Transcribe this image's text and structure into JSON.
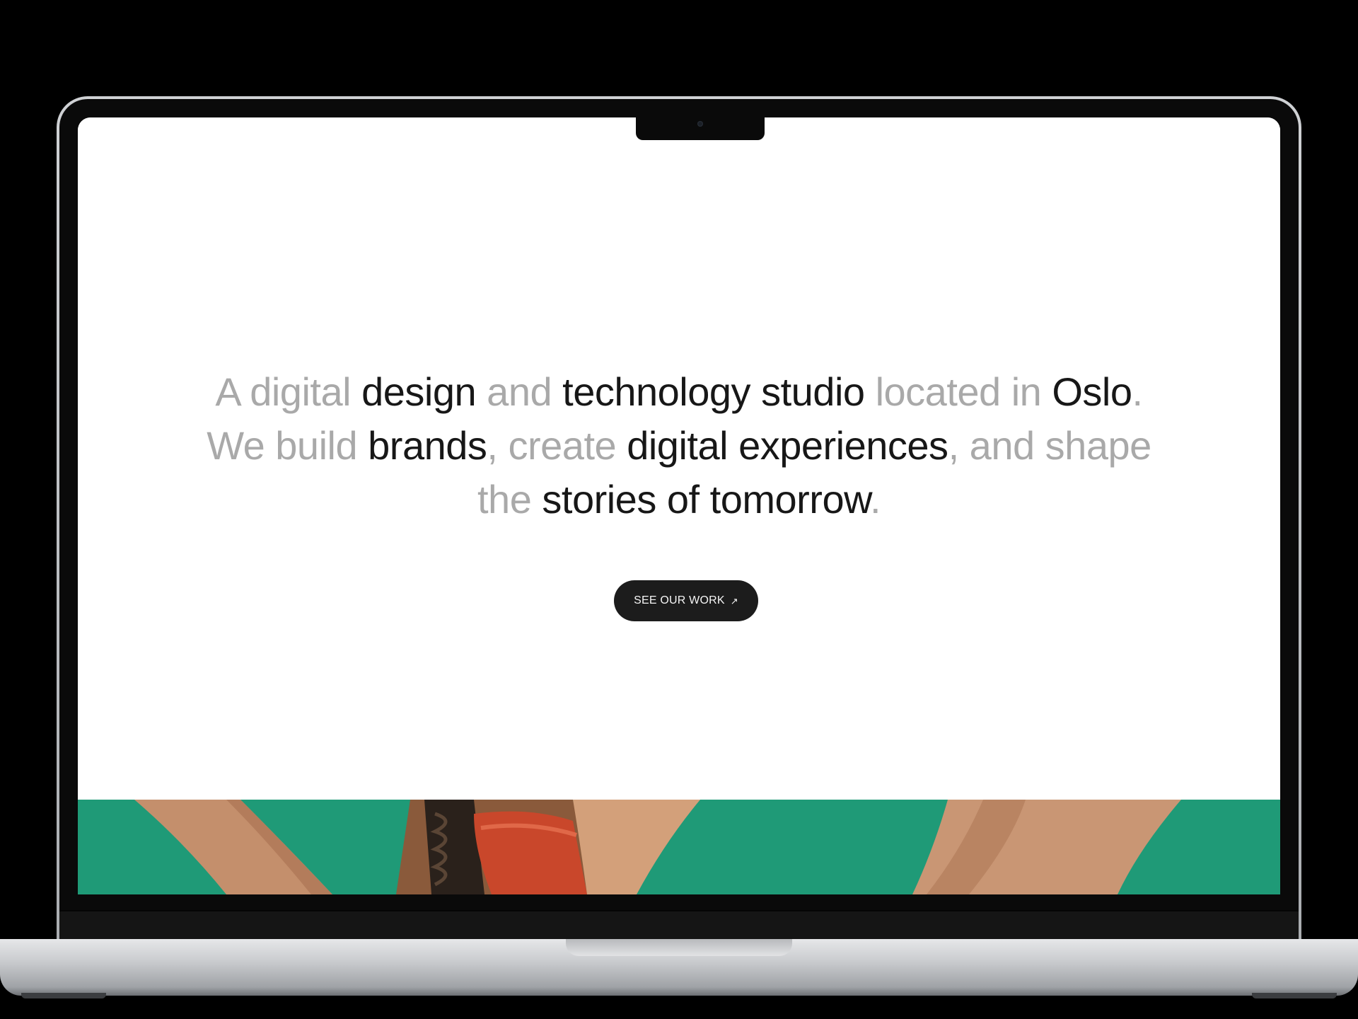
{
  "hero": {
    "headline_segments": [
      {
        "text": "A digital ",
        "tone": "muted"
      },
      {
        "text": "design ",
        "tone": "strong"
      },
      {
        "text": "and ",
        "tone": "muted"
      },
      {
        "text": "technology studio ",
        "tone": "strong"
      },
      {
        "text": "located in ",
        "tone": "muted"
      },
      {
        "text": "Oslo",
        "tone": "strong"
      },
      {
        "text": ".",
        "tone": "muted"
      },
      {
        "text": "We build ",
        "tone": "muted"
      },
      {
        "text": "brands",
        "tone": "strong"
      },
      {
        "text": ", create ",
        "tone": "muted"
      },
      {
        "text": "digital experiences",
        "tone": "strong"
      },
      {
        "text": ", and shape",
        "tone": "muted"
      },
      {
        "text": "the ",
        "tone": "muted"
      },
      {
        "text": "stories of tomorrow",
        "tone": "strong"
      },
      {
        "text": ".",
        "tone": "muted"
      }
    ],
    "cta": {
      "label": "SEE OUR WORK",
      "icon": "arrow-up-right-icon",
      "icon_glyph": "↗"
    }
  },
  "colors": {
    "text_strong": "#171717",
    "text_muted": "#a9a9a9",
    "button_bg": "#1c1c1c",
    "button_text": "#f5f5f5",
    "photo_green": "#1f9a77"
  }
}
